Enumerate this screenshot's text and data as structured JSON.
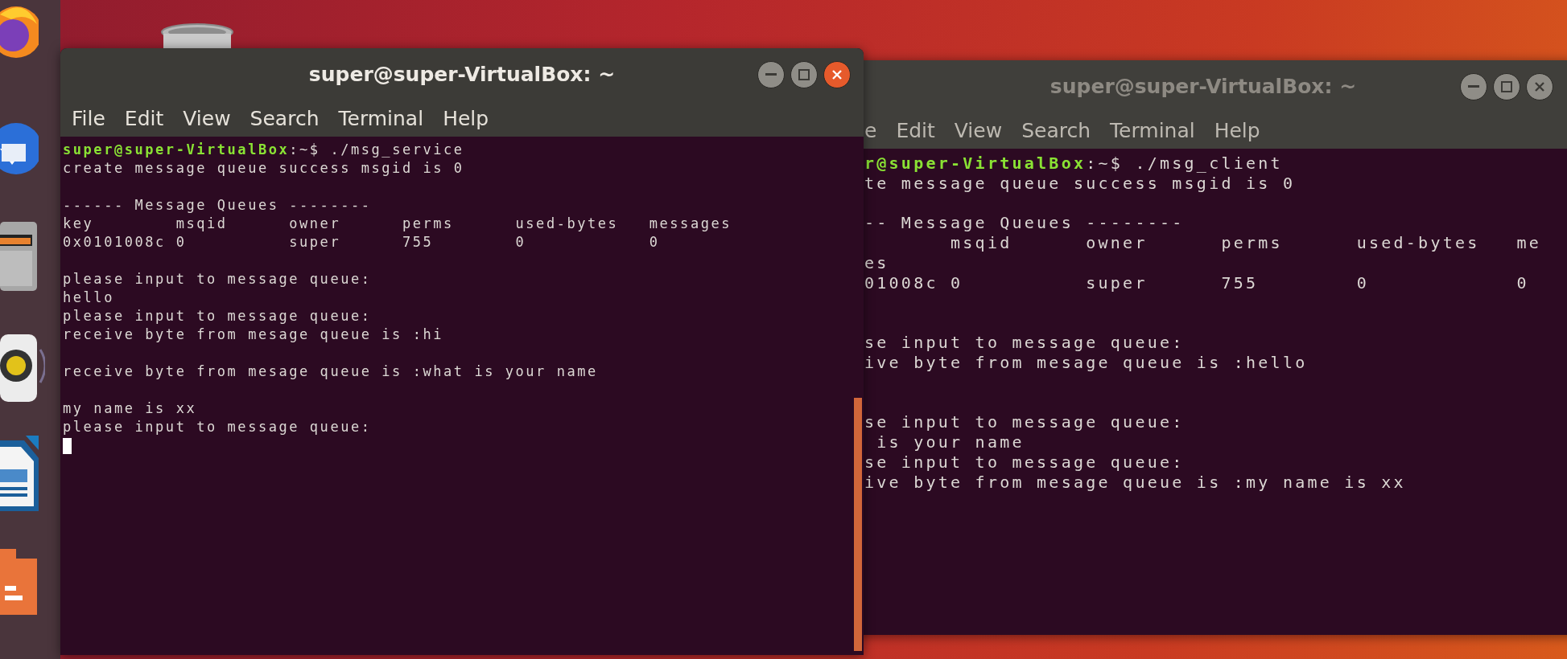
{
  "windows": [
    {
      "title": "super@super-VirtualBox: ~",
      "active": true,
      "cursor": true,
      "menu": [
        "File",
        "Edit",
        "View",
        "Search",
        "Terminal",
        "Help"
      ],
      "lines": [
        {
          "kind": "prompt",
          "user": "super@super-VirtualBox",
          "text": ":~$ ./msg_service"
        },
        {
          "kind": "output",
          "text": "create message queue success msgid is 0"
        },
        {
          "kind": "blank"
        },
        {
          "kind": "output",
          "text": "------ Message Queues --------"
        },
        {
          "kind": "output",
          "text": "key        msqid      owner      perms      used-bytes   messages"
        },
        {
          "kind": "output",
          "text": "0x0101008c 0          super      755        0            0"
        },
        {
          "kind": "blank"
        },
        {
          "kind": "output",
          "text": "please input to message queue:"
        },
        {
          "kind": "output",
          "text": "hello"
        },
        {
          "kind": "output",
          "text": "please input to message queue:"
        },
        {
          "kind": "output",
          "text": "receive byte from mesage queue is :hi"
        },
        {
          "kind": "blank"
        },
        {
          "kind": "output",
          "text": "receive byte from mesage queue is :what is your name"
        },
        {
          "kind": "blank"
        },
        {
          "kind": "output",
          "text": "my name is xx"
        },
        {
          "kind": "output",
          "text": "please input to message queue:"
        }
      ]
    },
    {
      "title": "super@super-VirtualBox: ~",
      "active": false,
      "cursor": false,
      "menu": [
        "e",
        "Edit",
        "View",
        "Search",
        "Terminal",
        "Help"
      ],
      "lines": [
        {
          "kind": "prompt",
          "user": "r@super-VirtualBox",
          "text": ":~$ ./msg_client"
        },
        {
          "kind": "output",
          "text": "te message queue success msgid is 0"
        },
        {
          "kind": "blank"
        },
        {
          "kind": "output",
          "text": "-- Message Queues --------"
        },
        {
          "kind": "output",
          "text": "       msqid      owner      perms      used-bytes   me"
        },
        {
          "kind": "output",
          "text": "es"
        },
        {
          "kind": "output",
          "text": "01008c 0          super      755        0            0"
        },
        {
          "kind": "blank"
        },
        {
          "kind": "blank"
        },
        {
          "kind": "output",
          "text": "se input to message queue:"
        },
        {
          "kind": "output",
          "text": "ive byte from mesage queue is :hello"
        },
        {
          "kind": "blank"
        },
        {
          "kind": "blank"
        },
        {
          "kind": "output",
          "text": "se input to message queue:"
        },
        {
          "kind": "output",
          "text": " is your name"
        },
        {
          "kind": "output",
          "text": "se input to message queue:"
        },
        {
          "kind": "output",
          "text": "ive byte from mesage queue is :my name is xx"
        }
      ]
    }
  ]
}
